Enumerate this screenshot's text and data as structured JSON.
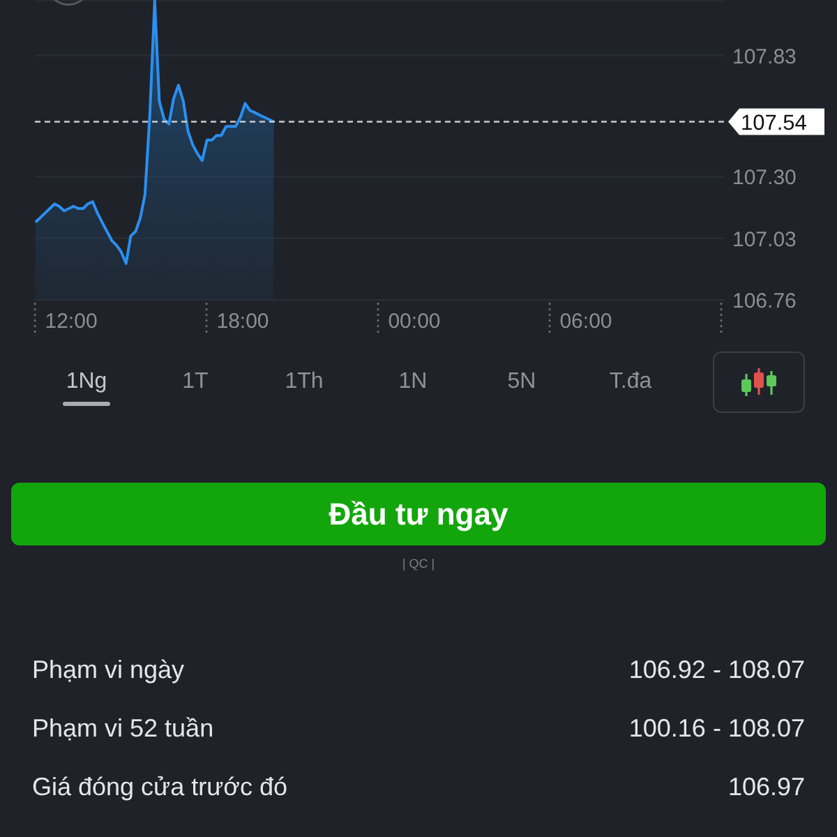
{
  "chart": {
    "chart_data": {
      "type": "area",
      "grid": true,
      "x": [
        10.75,
        10.92,
        11.08,
        11.25,
        11.42,
        11.58,
        11.75,
        11.92,
        12.08,
        12.25,
        12.42,
        12.58,
        12.75,
        12.92,
        13.08,
        13.25,
        13.42,
        13.58,
        13.75,
        13.92,
        14.08,
        14.25,
        14.42,
        14.58,
        14.75,
        14.92,
        15.08,
        15.25,
        15.42,
        15.58,
        15.75,
        15.92,
        16.08,
        16.25,
        16.42,
        16.58,
        16.75,
        16.92,
        17.08,
        17.25,
        17.42,
        17.58,
        17.75,
        17.92,
        18.08,
        18.25,
        18.42,
        18.58,
        18.75,
        18.92,
        19.08
      ],
      "series": [
        {
          "color": "#2b8ff0",
          "values": [
            107.1,
            107.12,
            107.14,
            107.16,
            107.18,
            107.17,
            107.15,
            107.16,
            107.17,
            107.16,
            107.16,
            107.18,
            107.19,
            107.14,
            107.1,
            107.06,
            107.02,
            107.0,
            106.97,
            106.92,
            107.04,
            107.06,
            107.12,
            107.22,
            107.57,
            108.07,
            107.63,
            107.55,
            107.53,
            107.64,
            107.7,
            107.63,
            107.5,
            107.44,
            107.4,
            107.37,
            107.46,
            107.46,
            107.48,
            107.48,
            107.52,
            107.52,
            107.52,
            107.56,
            107.62,
            107.59,
            107.58,
            107.57,
            107.56,
            107.55,
            107.54
          ]
        }
      ],
      "xlim": [
        10.73,
        34.83
      ],
      "xticks": [
        {
          "value": 12,
          "label": "12:00"
        },
        {
          "value": 18,
          "label": "18:00"
        }
      ],
      "ylim": [
        106.76,
        108.07
      ],
      "yticks": [
        {
          "value": 106.76,
          "label": "106.76"
        },
        {
          "value": 107.03,
          "label": "107.03"
        },
        {
          "value": 107.3,
          "label": "107.30"
        },
        {
          "value": 107.83,
          "label": "107.83"
        }
      ],
      "ref_lines": [
        {
          "axis": "y",
          "value": 107.54,
          "label": "107.54"
        }
      ]
    },
    "next_day_time_labels": [
      "00:00",
      "06:00"
    ]
  },
  "ranges": [
    {
      "label": "1Ng",
      "selected": true
    },
    {
      "label": "1T",
      "selected": false
    },
    {
      "label": "1Th",
      "selected": false
    },
    {
      "label": "1N",
      "selected": false
    },
    {
      "label": "5N",
      "selected": false
    },
    {
      "label": "T.đa",
      "selected": false
    }
  ],
  "invest_button": {
    "label": "Đầu tư ngay"
  },
  "ad_label": "| QC |",
  "stats": [
    {
      "label": "Phạm vi ngày",
      "value": "106.92 - 108.07"
    },
    {
      "label": "Phạm vi 52 tuần",
      "value": "100.16 - 108.07"
    },
    {
      "label": "Giá đóng cửa trước đó",
      "value": "106.97"
    }
  ]
}
